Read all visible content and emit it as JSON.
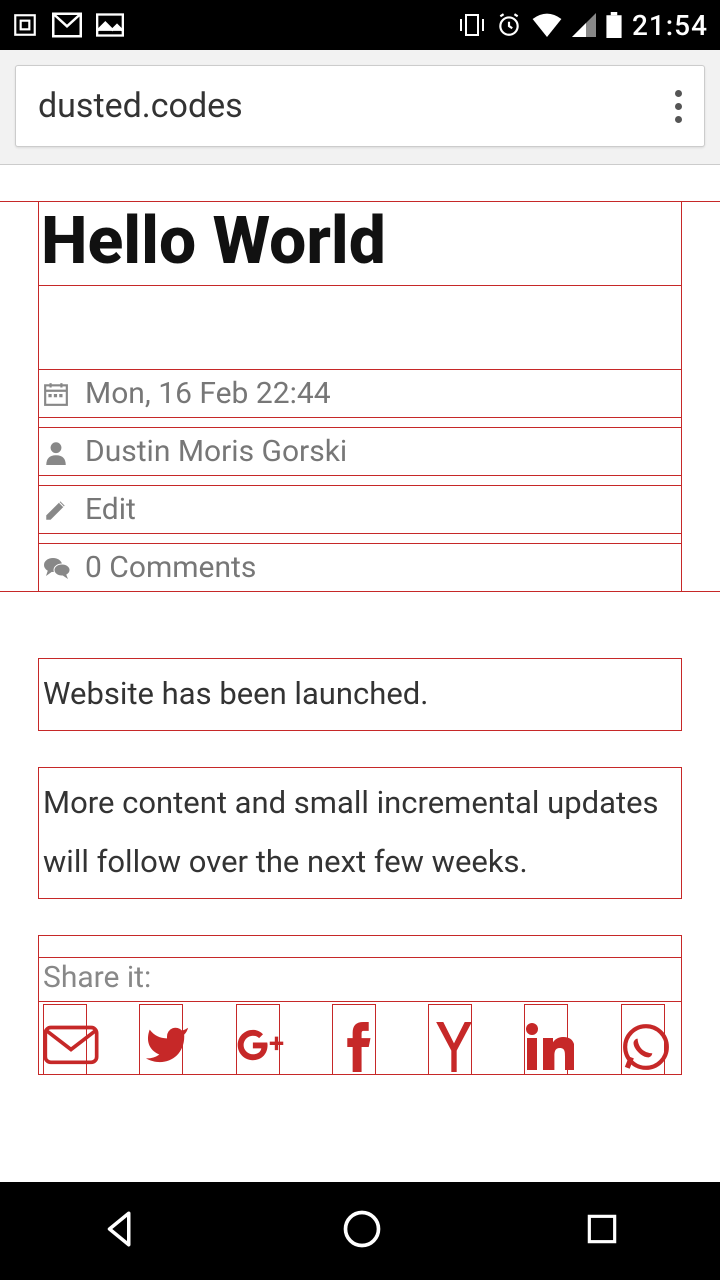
{
  "status_bar": {
    "time": "21:54"
  },
  "browser": {
    "url": "dusted.codes"
  },
  "article": {
    "title": "Hello World",
    "meta": {
      "date": "Mon, 16 Feb 22:44",
      "author": "Dustin Moris Gorski",
      "edit": "Edit",
      "comments": "0 Comments"
    },
    "paragraphs": [
      "Website has been launched.",
      "More content and small incremental updates will follow over the next few weeks."
    ],
    "share_label": "Share it:",
    "share_targets": [
      "email",
      "twitter",
      "googleplus",
      "facebook",
      "hackernews",
      "linkedin",
      "whatsapp"
    ]
  }
}
